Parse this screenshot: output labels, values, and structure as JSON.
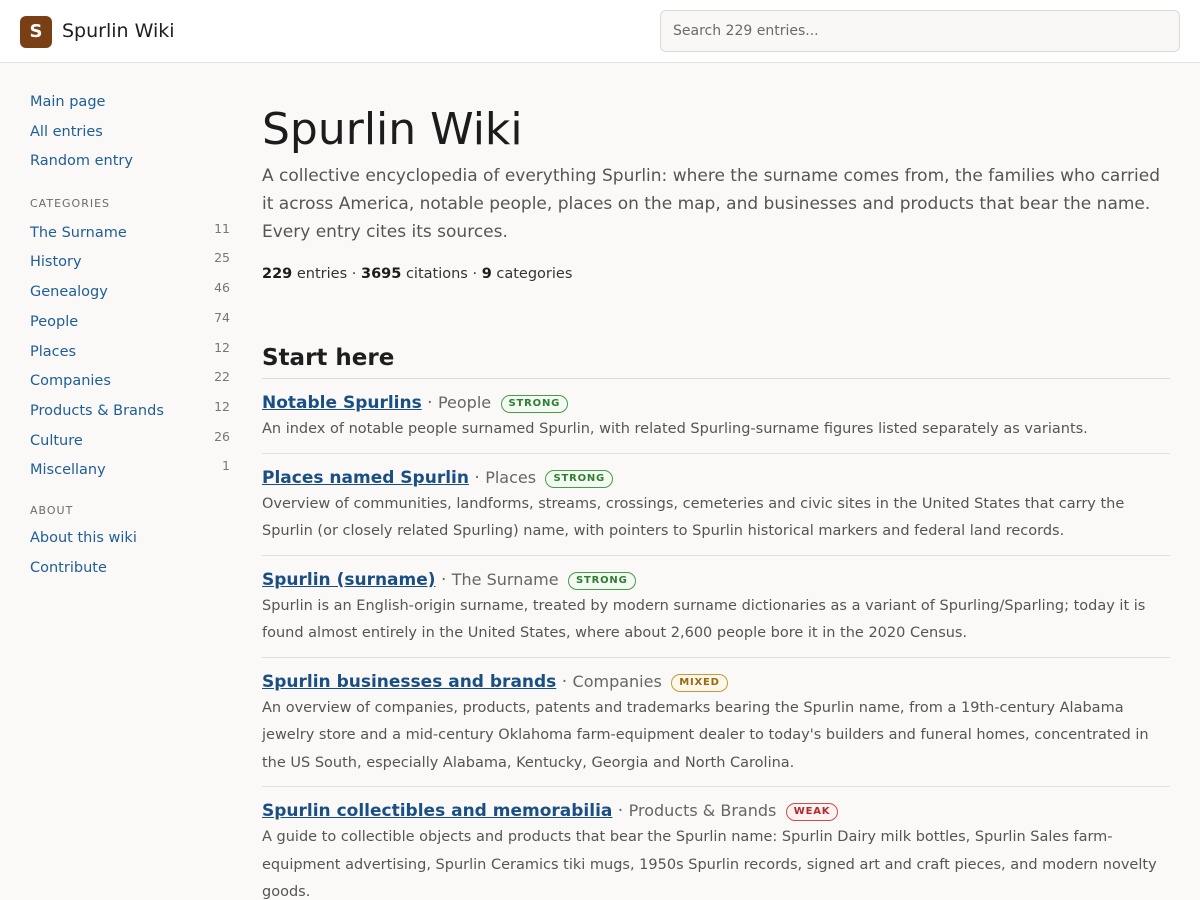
{
  "header": {
    "logo_letter": "S",
    "site_title": "Spurlin Wiki",
    "search_placeholder": "Search 229 entries..."
  },
  "sidebar": {
    "nav": [
      "Main page",
      "All entries",
      "Random entry"
    ],
    "categories_heading": "CATEGORIES",
    "categories": [
      {
        "label": "The Surname",
        "count": "11"
      },
      {
        "label": "History",
        "count": "25"
      },
      {
        "label": "Genealogy",
        "count": "46"
      },
      {
        "label": "People",
        "count": "74"
      },
      {
        "label": "Places",
        "count": "12"
      },
      {
        "label": "Companies",
        "count": "22"
      },
      {
        "label": "Products & Brands",
        "count": "12"
      },
      {
        "label": "Culture",
        "count": "26"
      },
      {
        "label": "Miscellany",
        "count": "1"
      }
    ],
    "about_heading": "ABOUT",
    "about": [
      "About this wiki",
      "Contribute"
    ]
  },
  "main": {
    "title": "Spurlin Wiki",
    "intro": "A collective encyclopedia of everything Spurlin: where the surname comes from, the families who carried it across America, notable people, places on the map, and businesses and products that bear the name. Every entry cites its sources.",
    "stats": {
      "entries_count": "229",
      "entries_label": "entries",
      "citations_count": "3695",
      "citations_label": "citations",
      "categories_count": "9",
      "categories_label": "categories",
      "separator": "·"
    },
    "start_heading": "Start here",
    "entries": [
      {
        "title": "Notable Spurlins",
        "category": "People",
        "badge": "STRONG",
        "description": "An index of notable people surnamed Spurlin, with related Spurling-surname figures listed separately as variants."
      },
      {
        "title": "Places named Spurlin",
        "category": "Places",
        "badge": "STRONG",
        "description": "Overview of communities, landforms, streams, crossings, cemeteries and civic sites in the United States that carry the Spurlin (or closely related Spurling) name, with pointers to Spurlin historical markers and federal land records."
      },
      {
        "title": "Spurlin (surname)",
        "category": "The Surname",
        "badge": "STRONG",
        "description": "Spurlin is an English-origin surname, treated by modern surname dictionaries as a variant of Spurling/Sparling; today it is found almost entirely in the United States, where about 2,600 people bore it in the 2020 Census."
      },
      {
        "title": "Spurlin businesses and brands",
        "category": "Companies",
        "badge": "MIXED",
        "description": "An overview of companies, products, patents and trademarks bearing the Spurlin name, from a 19th-century Alabama jewelry store and a mid-century Oklahoma farm-equipment dealer to today's builders and funeral homes, concentrated in the US South, especially Alabama, Kentucky, Georgia and North Carolina."
      },
      {
        "title": "Spurlin collectibles and memorabilia",
        "category": "Products & Brands",
        "badge": "WEAK",
        "description": "A guide to collectible objects and products that bear the Spurlin name: Spurlin Dairy milk bottles, Spurlin Sales farm-equipment advertising, Spurlin Ceramics tiki mugs, 1950s Spurlin records, signed art and craft pieces, and modern novelty goods."
      }
    ]
  },
  "colors": {
    "brand": "#7a3f14",
    "link": "#1f5e96",
    "strong": "#2e7d32",
    "mixed": "#9a6a10",
    "weak": "#b02a2a"
  }
}
